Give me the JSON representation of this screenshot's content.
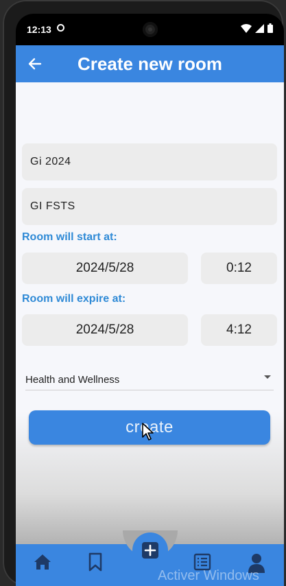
{
  "status": {
    "time": "12:13"
  },
  "appbar": {
    "title": "Create new room"
  },
  "form": {
    "room_name": "Gi 2024",
    "room_desc": "GI FSTS",
    "start_label": "Room will start at:",
    "start_date": "2024/5/28",
    "start_time": "0:12",
    "expire_label": "Room will expire at:",
    "expire_date": "2024/5/28",
    "expire_time": "4:12",
    "category": "Health and Wellness",
    "create_label": "create"
  },
  "bottom_nav": {
    "items": [
      "home-icon",
      "bookmark-icon",
      "add-icon",
      "list-icon",
      "profile-icon"
    ]
  },
  "watermark": "Activer Windows",
  "colors": {
    "primary": "#3a86e0",
    "label": "#2f8ad6",
    "field": "#ececec"
  }
}
